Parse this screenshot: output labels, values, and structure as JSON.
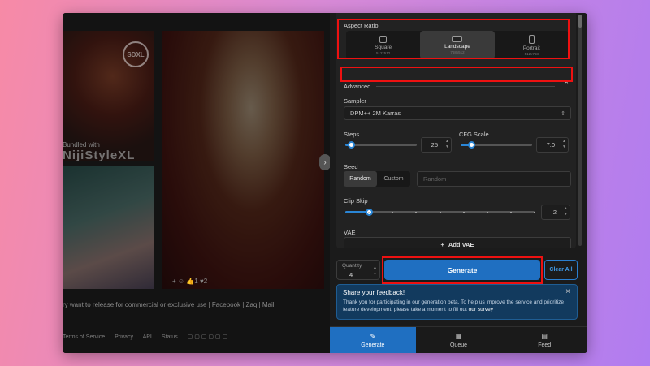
{
  "gallery": {
    "badge": "SDXL",
    "model_caption": "Bundled with",
    "model_name": "NijiStyleXL",
    "reactions": [
      "+",
      "1",
      "2"
    ],
    "license_text": "ry want to release for commercial or exclusive use | Facebook | Zaq | Mail",
    "footer_links": [
      "Terms of Service",
      "Privacy",
      "API",
      "Status"
    ]
  },
  "aspect_ratio": {
    "label": "Aspect Ratio",
    "options": [
      {
        "label": "Square",
        "dims": "512x512"
      },
      {
        "label": "Landscape",
        "dims": "768x512",
        "selected": true
      },
      {
        "label": "Portrait",
        "dims": "512x768"
      }
    ]
  },
  "advanced": {
    "label": "Advanced"
  },
  "sampler": {
    "label": "Sampler",
    "value": "DPM++ 2M Karras"
  },
  "steps": {
    "label": "Steps",
    "value": "25",
    "fraction": 0.08
  },
  "cfg": {
    "label": "CFG Scale",
    "value": "7.0",
    "fraction": 0.15
  },
  "seed": {
    "label": "Seed",
    "random_label": "Random",
    "custom_label": "Custom",
    "placeholder": "Random"
  },
  "clip_skip": {
    "label": "Clip Skip",
    "value": "2",
    "fraction": 0.125
  },
  "vae": {
    "label": "VAE",
    "add_label": "Add VAE"
  },
  "quantity": {
    "label": "Quantity",
    "value": "4"
  },
  "generate_label": "Generate",
  "clear_label": "Clear All",
  "feedback": {
    "title": "Share your feedback!",
    "body": "Thank you for participating in our generation beta. To help us improve the service and prioritize feature development, please take a moment to fill out ",
    "link": "our survey",
    "close": "×"
  },
  "tabs": [
    {
      "label": "Generate",
      "icon": "brush-icon",
      "active": true
    },
    {
      "label": "Queue",
      "icon": "queue-icon"
    },
    {
      "label": "Feed",
      "icon": "feed-icon"
    }
  ],
  "colors": {
    "accent": "#1f6fc1",
    "highlight": "#e11111"
  }
}
